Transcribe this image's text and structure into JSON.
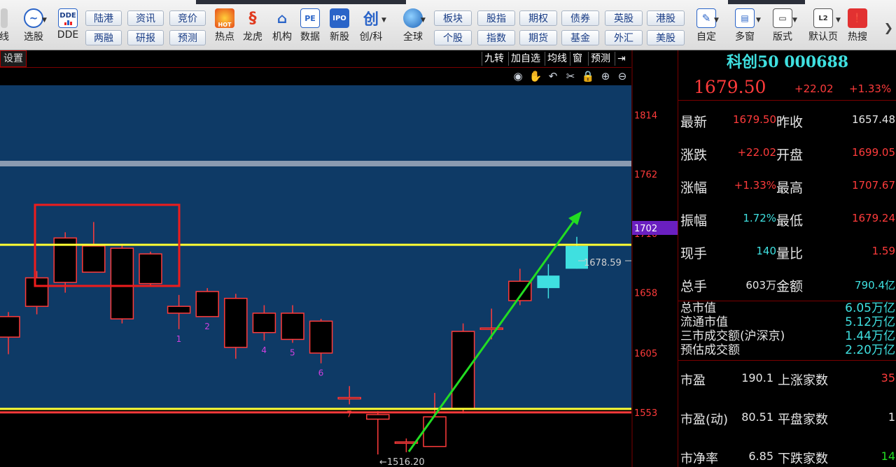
{
  "colors": {
    "up": "#ff3b3b",
    "down": "#3fe0e0",
    "neutral": "#e6e6e6",
    "chart_bg": "#0e3a66",
    "support_line": "#ffff33",
    "trend_arrow": "#22dd22",
    "highlight_box": "#ee1c1c",
    "label_magenta": "#d040e0"
  },
  "toolbar": {
    "left_partial_label": "线",
    "buttons": [
      {
        "label": "选股",
        "icon": "stock-pick-icon"
      },
      {
        "label": "DDE",
        "icon": "dde-icon"
      }
    ],
    "pairs": [
      {
        "top": "陆港",
        "bottom": "两融"
      },
      {
        "top": "资讯",
        "bottom": "研报"
      },
      {
        "top": "竞价",
        "bottom": "预测"
      }
    ],
    "icon_buttons": [
      {
        "label": "热点",
        "icon": "hot-icon"
      },
      {
        "label": "龙虎",
        "icon": "dragon-icon"
      },
      {
        "label": "机构",
        "icon": "institution-icon"
      },
      {
        "label": "数据",
        "icon": "data-pe-icon"
      },
      {
        "label": "新股",
        "icon": "ipo-icon"
      },
      {
        "label": "创/科",
        "icon": "chuang-icon"
      },
      {
        "label": "全球",
        "icon": "globe-icon"
      }
    ],
    "pairs2": [
      {
        "top": "板块",
        "bottom": "个股"
      },
      {
        "top": "股指",
        "bottom": "指数"
      },
      {
        "top": "期权",
        "bottom": "期货"
      },
      {
        "top": "债券",
        "bottom": "基金"
      },
      {
        "top": "英股",
        "bottom": "外汇"
      },
      {
        "top": "港股",
        "bottom": "美股"
      }
    ],
    "right_buttons": [
      {
        "label": "自定",
        "icon": "custom-icon"
      },
      {
        "label": "多窗",
        "icon": "multi-window-icon"
      },
      {
        "label": "版式",
        "icon": "layout-icon"
      },
      {
        "label": "默认页",
        "icon": "l2-home-icon"
      },
      {
        "label": "热搜",
        "icon": "hot-search-icon"
      }
    ],
    "ipo_text": "IPO",
    "pe_text": "PE",
    "l2_text": "L2",
    "dde_text": "DDE",
    "chuang_text": "创"
  },
  "chart": {
    "tab_label": "设置",
    "header_buttons": [
      "九转",
      "加自选",
      "均线",
      "窗",
      "预测"
    ],
    "tools": [
      "eye-icon",
      "hand-icon",
      "undo-icon",
      "scissors-icon",
      "lock-icon",
      "zoom-in-icon",
      "zoom-out-icon"
    ],
    "y_axis_ticks": [
      "1814",
      "1762",
      "1710",
      "1658",
      "1605",
      "1553"
    ],
    "current_price_tag": "1702",
    "price_marker": "1678.59",
    "low_marker": "1516.20",
    "count_labels": [
      "1",
      "2",
      "4",
      "5",
      "6",
      "7"
    ]
  },
  "chart_data": {
    "type": "candlestick",
    "y_axis_ticks": [
      1814,
      1762,
      1710,
      1658,
      1605,
      1553
    ],
    "ylim": [
      1505,
      1840
    ],
    "support_lines": [
      1700,
      1556
    ],
    "candles": [
      {
        "o": 1619,
        "c": 1637,
        "h": 1641,
        "l": 1604
      },
      {
        "o": 1646,
        "c": 1671,
        "h": 1677,
        "l": 1639
      },
      {
        "o": 1667,
        "c": 1706,
        "h": 1711,
        "l": 1658
      },
      {
        "o": 1676,
        "c": 1699,
        "h": 1720,
        "l": 1676
      },
      {
        "o": 1635,
        "c": 1697,
        "h": 1700,
        "l": 1631
      },
      {
        "o": 1666,
        "c": 1692,
        "h": 1694,
        "l": 1664
      },
      {
        "o": 1640,
        "c": 1646,
        "h": 1656,
        "l": 1626
      },
      {
        "o": 1637,
        "c": 1659,
        "h": 1662,
        "l": 1637
      },
      {
        "o": 1610,
        "c": 1653,
        "h": 1657,
        "l": 1600
      },
      {
        "o": 1623,
        "c": 1640,
        "h": 1647,
        "l": 1616
      },
      {
        "o": 1617,
        "c": 1640,
        "h": 1647,
        "l": 1614
      },
      {
        "o": 1605,
        "c": 1633,
        "h": 1635,
        "l": 1596
      },
      {
        "o": 1566,
        "c": 1566,
        "h": 1576,
        "l": 1560
      },
      {
        "o": 1547,
        "c": 1551,
        "h": 1554,
        "l": 1516
      },
      {
        "o": 1526,
        "c": 1527,
        "h": 1530,
        "l": 1518
      },
      {
        "o": 1523,
        "c": 1549,
        "h": 1570,
        "l": 1523
      },
      {
        "o": 1556,
        "c": 1624,
        "h": 1631,
        "l": 1552
      },
      {
        "o": 1627,
        "c": 1627,
        "h": 1644,
        "l": 1617
      },
      {
        "o": 1651,
        "c": 1668,
        "h": 1679,
        "l": 1647
      },
      {
        "o": 1673,
        "c": 1662,
        "h": 1683,
        "l": 1653
      },
      {
        "o": 1699,
        "c": 1679,
        "h": 1707,
        "l": 1679
      }
    ]
  },
  "panel": {
    "title": "科创50 000688",
    "last_price": "1679.50",
    "change": "+22.02",
    "change_pct": "+1.33%",
    "quotes": [
      {
        "l1": "最新",
        "v1": "1679.50",
        "c1": "up",
        "l2": "昨收",
        "v2": "1657.48",
        "c2": "neutral"
      },
      {
        "l1": "涨跌",
        "v1": "+22.02",
        "c1": "up",
        "l2": "开盘",
        "v2": "1699.05",
        "c2": "up"
      },
      {
        "l1": "涨幅",
        "v1": "+1.33%",
        "c1": "up",
        "l2": "最高",
        "v2": "1707.67",
        "c2": "up"
      },
      {
        "l1": "振幅",
        "v1": "1.72%",
        "c1": "down",
        "l2": "最低",
        "v2": "1679.24",
        "c2": "up"
      },
      {
        "l1": "现手",
        "v1": "140",
        "c1": "down",
        "l2": "量比",
        "v2": "1.59",
        "c2": "up"
      },
      {
        "l1": "总手",
        "v1": "603万",
        "c1": "neutral",
        "l2": "金额",
        "v2": "790.4亿",
        "c2": "down"
      }
    ],
    "caps": [
      {
        "l": "总市值",
        "v": "6.05万亿"
      },
      {
        "l": "流通市值",
        "v": "5.12万亿"
      },
      {
        "l": "三市成交额(沪深京)",
        "v": "1.44万亿"
      },
      {
        "l": "预估成交额",
        "v": "2.20万亿"
      }
    ],
    "breadth": [
      {
        "l1": "市盈",
        "v1": "190.1",
        "l2": "上涨家数",
        "v2": "35",
        "c2": "up"
      },
      {
        "l1": "市盈(动)",
        "v1": "80.51",
        "l2": "平盘家数",
        "v2": "1",
        "c2": "neutral"
      },
      {
        "l1": "市净率",
        "v1": "6.85",
        "l2": "下跌家数",
        "v2": "14",
        "c2": "trend"
      }
    ]
  }
}
